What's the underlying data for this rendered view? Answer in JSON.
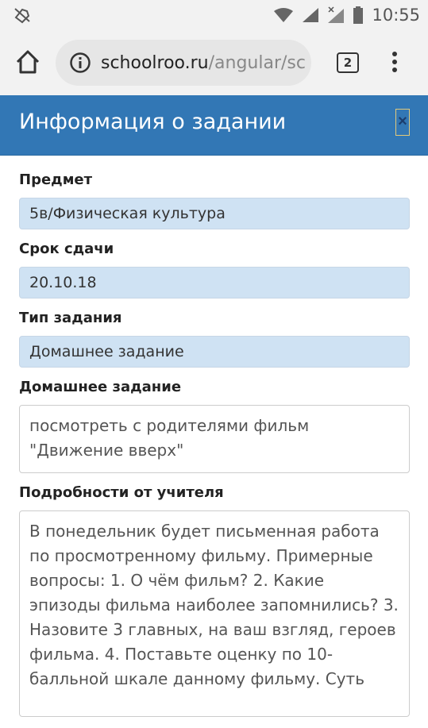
{
  "status_bar": {
    "time": "10:55"
  },
  "browser": {
    "url_host": "schoolroo.ru",
    "url_path": "/angular/sc",
    "tab_count": "2"
  },
  "modal": {
    "title": "Информация о задании",
    "close_label": "×",
    "fields": {
      "subject_label": "Предмет",
      "subject_value": "5в/Физическая культура",
      "due_label": "Срок сдачи",
      "due_value": "20.10.18",
      "type_label": "Тип задания",
      "type_value": "Домашнее задание",
      "homework_label": "Домашнее задание",
      "homework_value": "посмотреть с родителями фильм \"Движение вверх\"",
      "notes_label": "Подробности от учителя",
      "notes_value": "В понедельник будет письменная работа по просмотренному фильму. Примерные вопросы: 1. О чём фильм? 2. Какие эпизоды фильма наиболее запомнились? 3. Назовите 3 главных, на ваш взгляд, героев фильма. 4. Поставьте оценку по 10-балльной шкале данному фильму. Суть"
    }
  },
  "colors": {
    "header_bg": "#3277b5",
    "field_bg": "#cfe2f3"
  }
}
